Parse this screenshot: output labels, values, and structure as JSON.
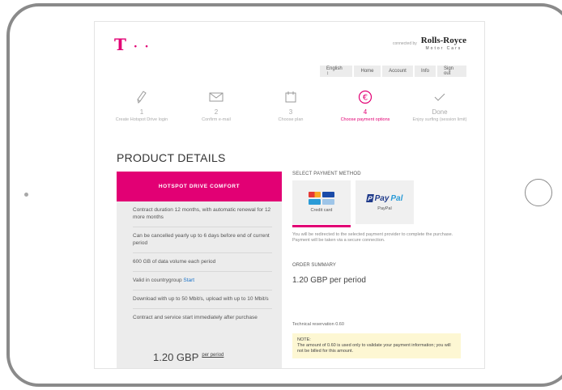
{
  "brand": {
    "logo": "T",
    "logo_dots": "· ·",
    "accent": "#e20074"
  },
  "partner": {
    "prefix": "connected by",
    "name": "Rolls-Royce",
    "sub": "Motor Cars"
  },
  "nav": {
    "language": "English ↕",
    "items": [
      "Home",
      "Account",
      "Info",
      "Sign out"
    ]
  },
  "steps": [
    {
      "num": "1",
      "label": "Create Hotspot Drive login",
      "icon": "pencil-icon"
    },
    {
      "num": "2",
      "label": "Confirm e-mail",
      "icon": "envelope-icon"
    },
    {
      "num": "3",
      "label": "Choose plan",
      "icon": "calendar-icon"
    },
    {
      "num": "4",
      "label": "Choose payment options",
      "icon": "euro-icon"
    },
    {
      "num": "Done",
      "label": "Enjoy surfing (session limit)",
      "icon": "check-icon"
    }
  ],
  "page": {
    "title": "PRODUCT DETAILS"
  },
  "product": {
    "name": "HOTSPOT DRIVE COMFORT",
    "features": [
      "Contract duration 12 months, with automatic renewal for 12 more months",
      "Can be cancelled yearly up to 6 days before end of current period",
      "600 GB of data volume each period",
      "Valid in countrygroup ",
      "Download with up to 50 Mbit/s, upload with up to 10 Mbit/s",
      "Contract and service start immediately after purchase"
    ],
    "country_link": "Start",
    "price": "1.20 GBP",
    "price_unit": "per period"
  },
  "payment": {
    "section_title": "SELECT PAYMENT METHOD",
    "methods": [
      {
        "label": "Credit card",
        "icon": "credit-cards-icon",
        "selected": true
      },
      {
        "label": "PayPal",
        "icon": "paypal-icon",
        "selected": false
      }
    ],
    "paypal_logo": {
      "p": "P",
      "pay": "Pay",
      "pal": "Pal"
    },
    "redirect_text": "You will be redirected to the selected payment provider to complete the purchase. Payment will be taken via a secure connection."
  },
  "summary": {
    "title": "ORDER SUMMARY",
    "price": "1.20 GBP per period",
    "reservation": "Technical reservation 0.60",
    "note": "NOTE:\nThe amount of 0.60 is used only to validate your payment information; you will not be billed for this amount."
  },
  "colors": {
    "card_red": "#e53935",
    "card_yellow": "#f9a825",
    "visa_blue": "#1a4ba8",
    "paypal_dark": "#1f3a8a",
    "paypal_light": "#2a9bd7"
  }
}
